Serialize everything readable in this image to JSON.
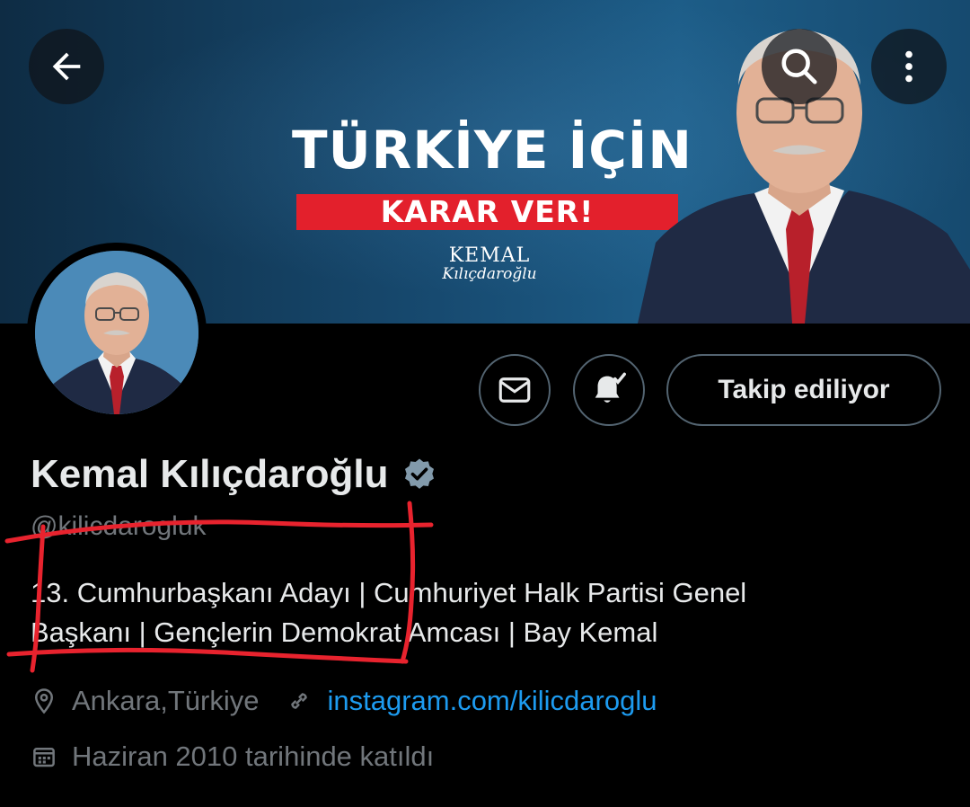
{
  "banner": {
    "headline": "TÜRKİYE İÇİN",
    "subheadline": "KARAR VER!",
    "signature_top": "KEMAL",
    "signature_bottom": "Kılıçdaroğlu"
  },
  "header_icons": {
    "back": "arrow-left-icon",
    "search": "search-icon",
    "more": "more-vertical-icon"
  },
  "actions": {
    "message_icon": "envelope-icon",
    "notify_icon": "bell-check-icon",
    "following_label": "Takip ediliyor"
  },
  "profile": {
    "display_name": "Kemal Kılıçdaroğlu",
    "handle": "@kilicdarogluk",
    "bio_line_1": "13. Cumhurbaşkanı Adayı | Cumhuriyet Halk Partisi Genel",
    "bio_line_2": "Başkanı | Gençlerin Demokrat Amcası | Bay Kemal",
    "location": "Ankara,Türkiye",
    "website": "instagram.com/kilicdaroglu",
    "joined": "Haziran 2010 tarihinde katıldı"
  },
  "colors": {
    "accent": "#1d9bf0",
    "secondary_text": "#71767b",
    "verified_badge": "#829aab",
    "annotation": "#e8232e"
  }
}
